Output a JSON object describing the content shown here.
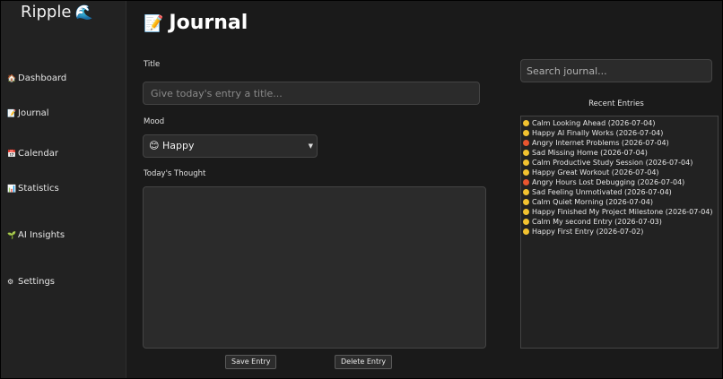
{
  "app": {
    "brand": "Ripple",
    "brand_icon": "🌊"
  },
  "sidebar": {
    "items": [
      {
        "label": "Dashboard",
        "icon": "house-icon",
        "glyph": "🏠"
      },
      {
        "label": "Journal",
        "icon": "memo-icon",
        "glyph": "📝"
      },
      {
        "label": "Calendar",
        "icon": "calendar-icon",
        "glyph": "📅"
      },
      {
        "label": "Statistics",
        "icon": "chart-icon",
        "glyph": "📊"
      },
      {
        "label": "AI Insights",
        "icon": "seedling-icon",
        "glyph": "🌱"
      },
      {
        "label": "Settings",
        "icon": "gear-icon",
        "glyph": "⚙"
      }
    ]
  },
  "main": {
    "title": "Journal",
    "title_icon": "📝",
    "title_label": "Title",
    "title_placeholder": "Give today's entry a title...",
    "mood_label": "Mood",
    "mood_value": "😊 Happy",
    "thought_label": "Today's Thought",
    "thought_value": "",
    "save_label": "Save Entry",
    "delete_label": "Delete Entry"
  },
  "recent": {
    "search_placeholder": "Search journal...",
    "heading": "Recent Entries",
    "entries": [
      {
        "mood": "Calm",
        "title": "Looking Ahead",
        "date": "2026-07-04"
      },
      {
        "mood": "Happy",
        "title": "AI Finally Works",
        "date": "2026-07-04"
      },
      {
        "mood": "Angry",
        "title": "Internet Problems",
        "date": "2026-07-04"
      },
      {
        "mood": "Sad",
        "title": "Missing Home",
        "date": "2026-07-04"
      },
      {
        "mood": "Calm",
        "title": "Productive Study Session",
        "date": "2026-07-04"
      },
      {
        "mood": "Happy",
        "title": "Great Workout",
        "date": "2026-07-04"
      },
      {
        "mood": "Angry",
        "title": "Hours Lost Debugging",
        "date": "2026-07-04"
      },
      {
        "mood": "Sad",
        "title": "Feeling Unmotivated",
        "date": "2026-07-04"
      },
      {
        "mood": "Calm",
        "title": "Quiet Morning",
        "date": "2026-07-04"
      },
      {
        "mood": "Happy",
        "title": "Finished My Project Milestone",
        "date": "2026-07-04"
      },
      {
        "mood": "Calm",
        "title": "My second Entry",
        "date": "2026-07-03"
      },
      {
        "mood": "Happy",
        "title": "First Entry",
        "date": "2026-07-02"
      }
    ],
    "mood_colors": {
      "Calm": "#f2c230",
      "Happy": "#f2c230",
      "Angry": "#e8552f",
      "Sad": "#f2c230"
    }
  }
}
